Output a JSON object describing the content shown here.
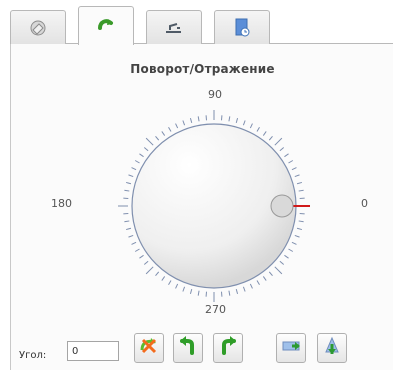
{
  "panel": {
    "title": "Поворот/Отражение"
  },
  "tabs": [
    {
      "name": "object-tab",
      "icon": "shape-icon",
      "active": false
    },
    {
      "name": "transform-tab",
      "icon": "rotate-icon",
      "active": true
    },
    {
      "name": "align-tab",
      "icon": "align-icon",
      "active": false
    },
    {
      "name": "properties-tab",
      "icon": "document-settings-icon",
      "active": false
    }
  ],
  "dial": {
    "angle": 0,
    "labels": {
      "top": "90",
      "left": "180",
      "right": "0",
      "bottom": "270"
    }
  },
  "controls": {
    "angle_label": "Угол:",
    "angle_value": "0",
    "buttons": [
      {
        "name": "reset-rotation-button",
        "icon": "reset-rotation-icon"
      },
      {
        "name": "rotate-left-button",
        "icon": "rotate-left-icon"
      },
      {
        "name": "rotate-right-button",
        "icon": "rotate-right-icon"
      },
      {
        "name": "flip-horizontal-button",
        "icon": "flip-horizontal-icon"
      },
      {
        "name": "flip-vertical-button",
        "icon": "flip-vertical-icon"
      }
    ]
  },
  "colors": {
    "tab_accent_green": "#3a9a2a",
    "dial_scale": "#7f8fae",
    "dial_zero_mark": "#d11a1a"
  }
}
